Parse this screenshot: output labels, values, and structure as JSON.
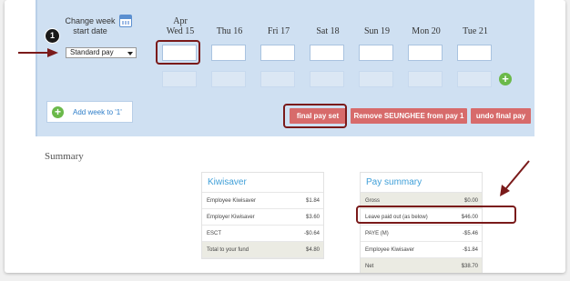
{
  "week": {
    "change_label": "Change week",
    "start_label": "start date"
  },
  "days": [
    {
      "top": "Apr",
      "label": "Wed 15"
    },
    {
      "top": "",
      "label": "Thu 16"
    },
    {
      "top": "",
      "label": "Fri 17"
    },
    {
      "top": "",
      "label": "Sat 18"
    },
    {
      "top": "",
      "label": "Sun 19"
    },
    {
      "top": "",
      "label": "Mon 20"
    },
    {
      "top": "",
      "label": "Tue 21"
    }
  ],
  "pay_type": {
    "selected": "Standard pay"
  },
  "actions": {
    "add_week": "Add week to '1'",
    "final_pay_set": "final pay set",
    "remove": "Remove SEUNGHEE from pay 1",
    "undo": "undo final pay"
  },
  "summary": {
    "title": "Summary",
    "kiwisaver": {
      "title": "Kiwisaver",
      "rows": [
        {
          "label": "Employee Kiwisaver",
          "value": "$1.84"
        },
        {
          "label": "Employer Kiwisaver",
          "value": "$3.60"
        },
        {
          "label": "ESCT",
          "value": "-$0.64"
        },
        {
          "label": "Total to your fund",
          "value": "$4.80"
        }
      ]
    },
    "pay_summary": {
      "title": "Pay summary",
      "rows": [
        {
          "label": "Gross",
          "value": "$0.00"
        },
        {
          "label": "Leave paid out (as below)",
          "value": "$46.00"
        },
        {
          "label": "PAYE (M)",
          "value": "-$5.46"
        },
        {
          "label": "Employee Kiwisaver",
          "value": "-$1.84"
        },
        {
          "label": "Net",
          "value": "$38.70"
        }
      ]
    }
  },
  "annotation": {
    "step": "1"
  },
  "colors": {
    "panel_bg": "#cfe0f2",
    "accent_blue": "#3f9fd8",
    "button_red": "#d76b6b",
    "add_green": "#6bb94a",
    "highlight": "#7a1a1a"
  }
}
